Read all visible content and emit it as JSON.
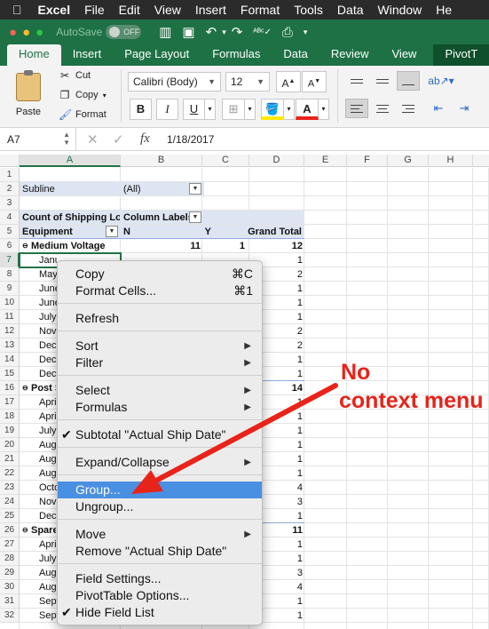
{
  "menubar": {
    "apple": "",
    "app": "Excel",
    "items": [
      "File",
      "Edit",
      "View",
      "Insert",
      "Format",
      "Tools",
      "Data",
      "Window",
      "He"
    ]
  },
  "titlebar": {
    "autosave": "AutoSave",
    "toggle": "OFF"
  },
  "ribbon_tabs": [
    "Home",
    "Insert",
    "Page Layout",
    "Formulas",
    "Data",
    "Review",
    "View"
  ],
  "pivot_tab": "PivotT",
  "clipboard": {
    "paste": "Paste",
    "cut": "Cut",
    "copy": "Copy",
    "format": "Format"
  },
  "font": {
    "name": "Calibri (Body)",
    "size": "12"
  },
  "formula_bar": {
    "name_box": "A7",
    "fx": "fx",
    "value": "1/18/2017"
  },
  "columns": [
    "A",
    "B",
    "C",
    "D",
    "E",
    "F",
    "G",
    "H"
  ],
  "rows": [
    "1",
    "2",
    "3",
    "4",
    "5",
    "6",
    "7",
    "8",
    "9",
    "10",
    "11",
    "12",
    "13",
    "14",
    "15",
    "16",
    "17",
    "18",
    "19",
    "20",
    "21",
    "22",
    "23",
    "24",
    "25",
    "26",
    "27",
    "28",
    "29",
    "30",
    "31",
    "32"
  ],
  "pivot": {
    "filter_label": "Subline",
    "filter_value": "(All)",
    "count_label": "Count of Shipping Loc",
    "column_labels": "Column Labels",
    "row_label": "Equipment",
    "col_n": "N",
    "col_y": "Y",
    "grand_total": "Grand Total",
    "group1": {
      "name": "Medium Voltage",
      "n": "11",
      "y": "1",
      "total": "12"
    },
    "group2": {
      "name": "Post S",
      "total": "14"
    },
    "group3": {
      "name": "Spare",
      "total": "11"
    },
    "items": [
      {
        "label": "Janu",
        "total": "1"
      },
      {
        "label": "May",
        "total": "2"
      },
      {
        "label": "June",
        "total": "1"
      },
      {
        "label": "June",
        "total": "1"
      },
      {
        "label": "July",
        "total": "1"
      },
      {
        "label": "Nov",
        "total": "2"
      },
      {
        "label": "Dece",
        "total": "2"
      },
      {
        "label": "Dece",
        "total": "1"
      },
      {
        "label": "Dece",
        "total": "1"
      },
      {
        "label": "",
        "total": ""
      },
      {
        "label": "Apri",
        "total": "1"
      },
      {
        "label": "Apri",
        "total": "1"
      },
      {
        "label": "July",
        "total": "1"
      },
      {
        "label": "Aug",
        "total": "1"
      },
      {
        "label": "Aug",
        "total": "1"
      },
      {
        "label": "Aug",
        "total": "1"
      },
      {
        "label": "Octo",
        "total": "4"
      },
      {
        "label": "Nov",
        "total": "3"
      },
      {
        "label": "Dece",
        "total": "1"
      },
      {
        "label": "",
        "total": ""
      },
      {
        "label": "Apri",
        "total": "1"
      },
      {
        "label": "July",
        "total": "1"
      },
      {
        "label": "Aug",
        "total": "3"
      },
      {
        "label": "Aug",
        "total": "4"
      },
      {
        "label": "Sept",
        "total": "1"
      },
      {
        "label": "Sept",
        "total": "1"
      }
    ]
  },
  "context_menu": {
    "copy": "Copy",
    "copy_sc": "⌘C",
    "format_cells": "Format Cells...",
    "format_sc": "⌘1",
    "refresh": "Refresh",
    "sort": "Sort",
    "filter": "Filter",
    "select": "Select",
    "formulas": "Formulas",
    "subtotal": "Subtotal \"Actual Ship Date\"",
    "expand": "Expand/Collapse",
    "group": "Group...",
    "ungroup": "Ungroup...",
    "move": "Move",
    "remove": "Remove \"Actual Ship Date\"",
    "field_settings": "Field Settings...",
    "pivot_options": "PivotTable Options...",
    "hide_field_list": "Hide Field List"
  },
  "annotation": {
    "line1": "No",
    "line2": "context menu",
    "color": "#e8231a"
  }
}
